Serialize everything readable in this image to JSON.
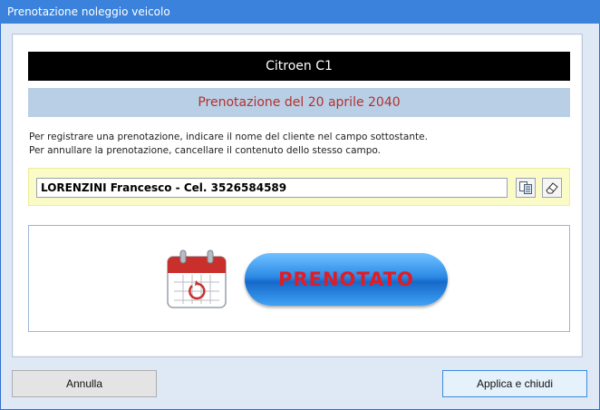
{
  "window": {
    "title": "Prenotazione noleggio veicolo"
  },
  "vehicle": {
    "name": "Citroen C1"
  },
  "booking": {
    "date_label": "Prenotazione del 20 aprile 2040"
  },
  "instructions": {
    "line1": "Per registrare una prenotazione, indicare il nome del cliente nel campo sottostante.",
    "line2": "Per annullare la prenotazione, cancellare il contenuto dello stesso campo."
  },
  "client_field": {
    "value": "LORENZINI Francesco - Cel. 3526584589"
  },
  "status": {
    "label": "PRENOTATO",
    "icon": "calendar-icon"
  },
  "buttons": {
    "cancel": "Annulla",
    "apply": "Applica e chiudi"
  },
  "colors": {
    "title_bar": "#3b82dc",
    "date_text": "#b2322e",
    "status_text": "#e31b23",
    "field_bg": "#fbfbc8"
  }
}
